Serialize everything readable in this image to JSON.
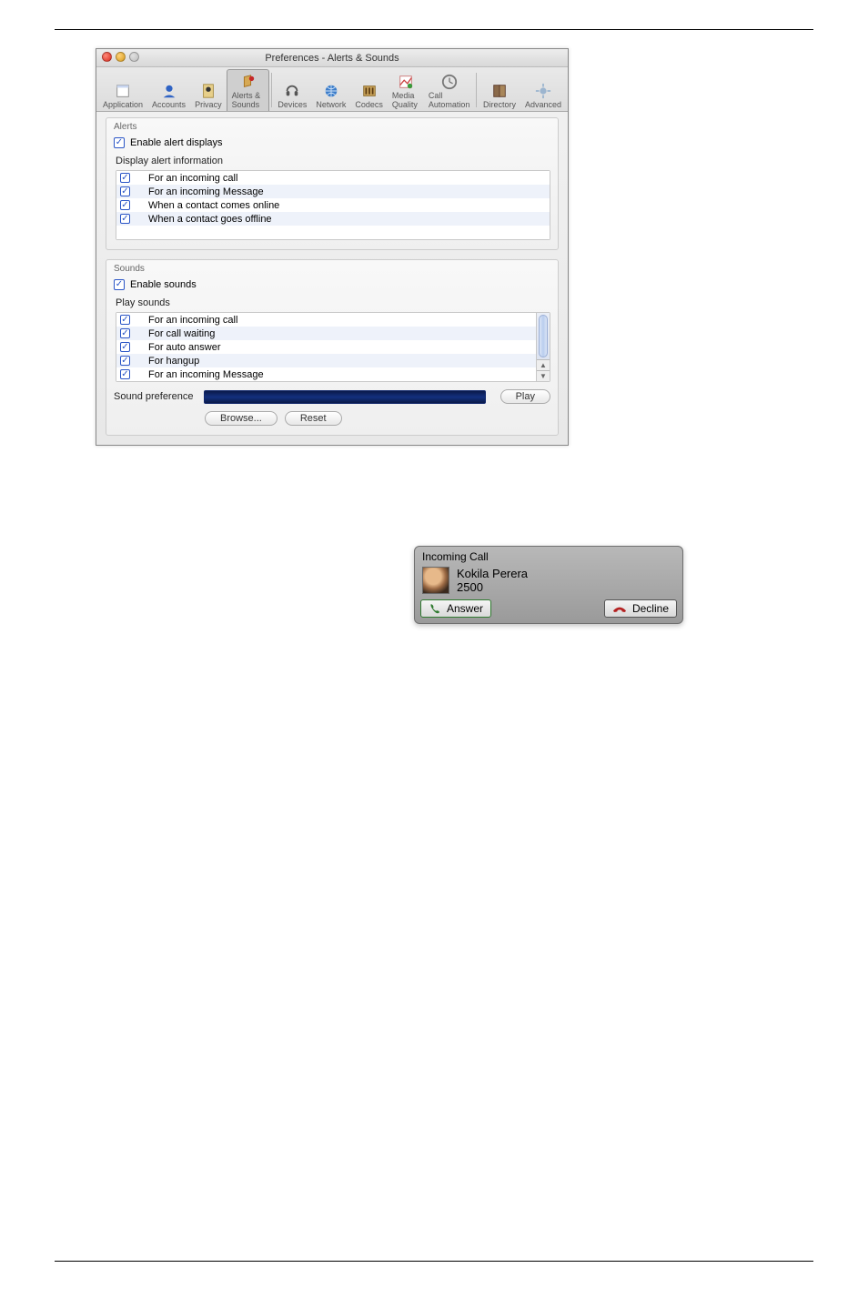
{
  "window": {
    "title": "Preferences - Alerts & Sounds",
    "tabs": [
      {
        "label": "Application"
      },
      {
        "label": "Accounts"
      },
      {
        "label": "Privacy"
      },
      {
        "label": "Alerts & Sounds"
      },
      {
        "label": "Devices"
      },
      {
        "label": "Network"
      },
      {
        "label": "Codecs"
      },
      {
        "label": "Media Quality"
      },
      {
        "label": "Call Automation"
      },
      {
        "label": "Directory"
      },
      {
        "label": "Advanced"
      }
    ]
  },
  "alerts": {
    "section": "Alerts",
    "enable": "Enable alert displays",
    "display_label": "Display alert information",
    "items": [
      "For an incoming call",
      "For an incoming Message",
      "When a contact comes online",
      "When a contact goes offline"
    ]
  },
  "sounds": {
    "section": "Sounds",
    "enable": "Enable sounds",
    "play_label": "Play sounds",
    "items": [
      "For an incoming call",
      "For call waiting",
      "For auto answer",
      "For hangup",
      "For an incoming Message"
    ],
    "pref_label": "Sound preference",
    "browse": "Browse...",
    "reset": "Reset",
    "play": "Play"
  },
  "toast": {
    "title": "Incoming Call",
    "name": "Kokila Perera",
    "number": "2500",
    "answer": "Answer",
    "decline": "Decline"
  }
}
